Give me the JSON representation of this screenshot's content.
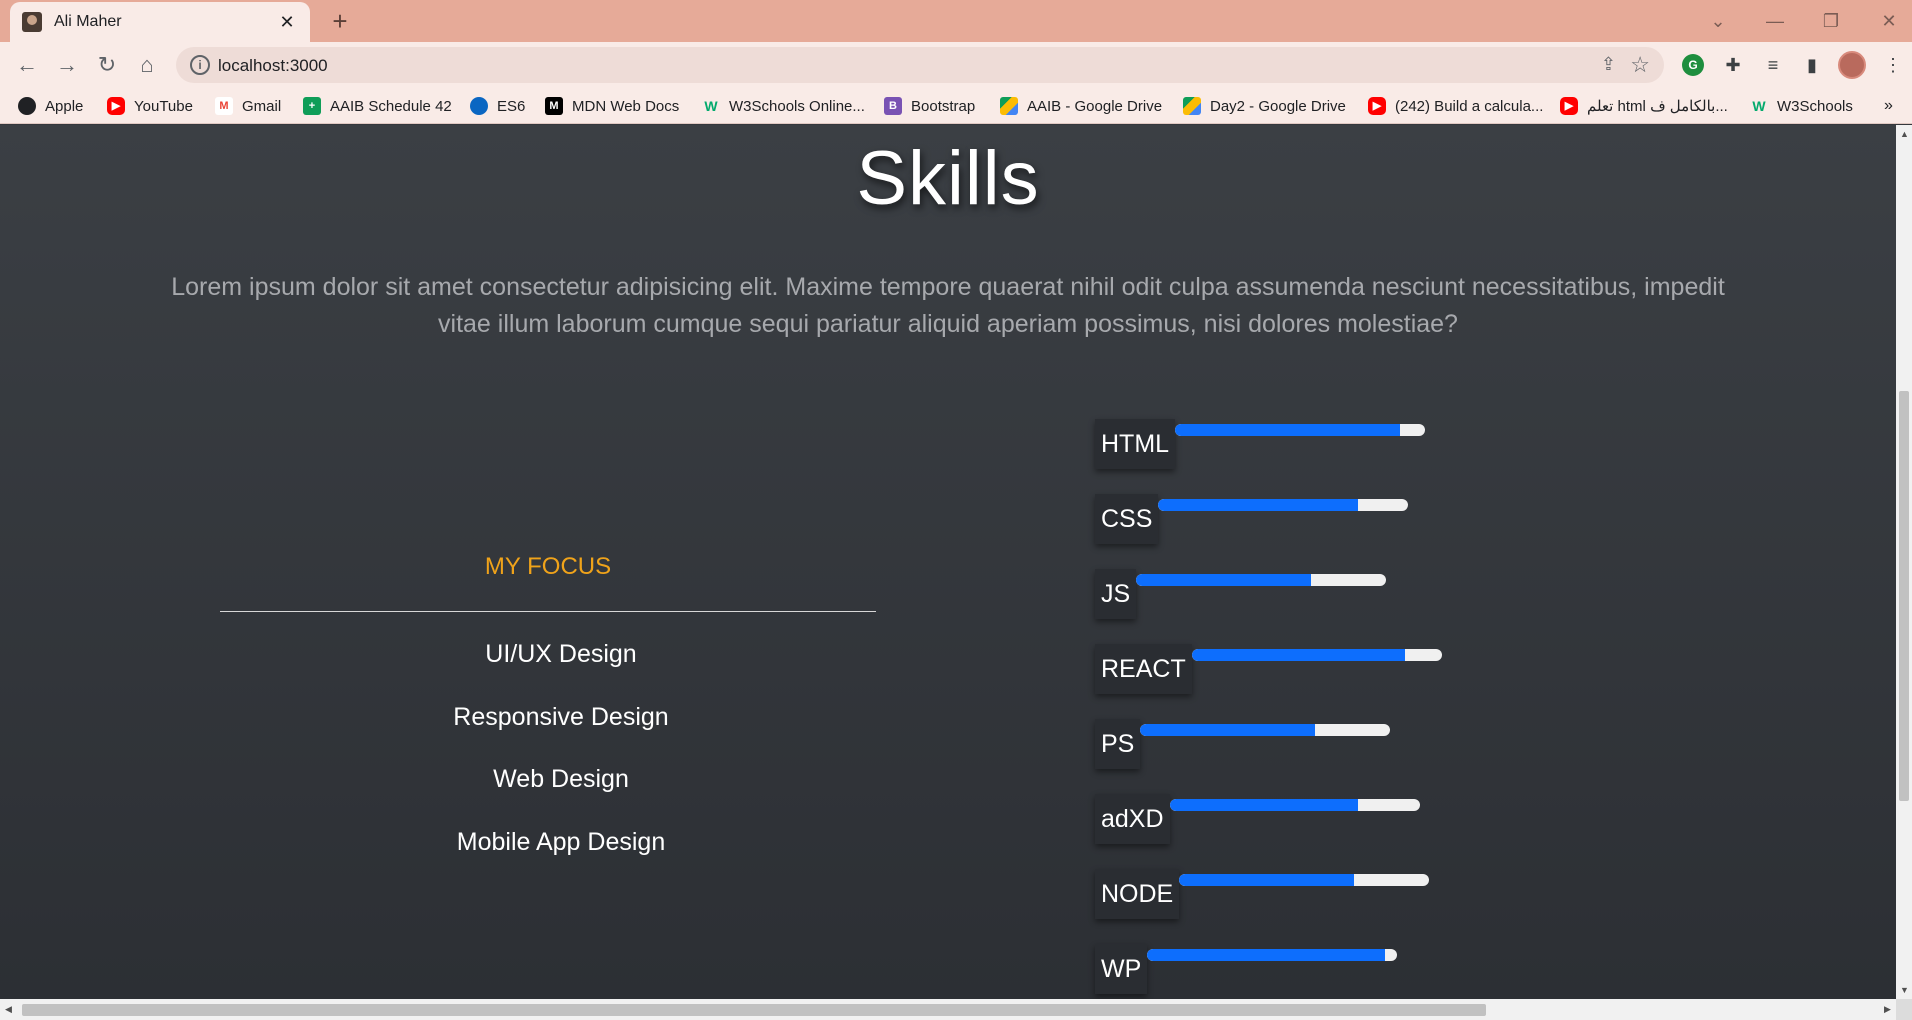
{
  "browser": {
    "tab_title": "Ali Maher",
    "new_tab": "+",
    "url": "localhost:3000",
    "accent_color": "#e6aa98"
  },
  "bookmarks": [
    {
      "label": "Apple",
      "icon": "globe-icon",
      "color": "#202124"
    },
    {
      "label": "YouTube",
      "icon": "youtube-icon",
      "color": "#ff0000"
    },
    {
      "label": "Gmail",
      "icon": "gmail-icon",
      "color": "#ea4335"
    },
    {
      "label": "AAIB Schedule 42",
      "icon": "sheets-icon",
      "color": "#0f9d58"
    },
    {
      "label": "ES6",
      "icon": "onedrive-icon",
      "color": "#0a66c2"
    },
    {
      "label": "MDN Web Docs",
      "icon": "mdn-icon",
      "color": "#000000"
    },
    {
      "label": "W3Schools Online...",
      "icon": "w3schools-icon",
      "color": "#04aa6d"
    },
    {
      "label": "Bootstrap",
      "icon": "bootstrap-icon",
      "color": "#7952b3"
    },
    {
      "label": "AAIB - Google Drive",
      "icon": "drive-icon",
      "color": "#fbbc04"
    },
    {
      "label": "Day2 - Google Drive",
      "icon": "drive-icon",
      "color": "#fbbc04"
    },
    {
      "label": "(242) Build a calcula...",
      "icon": "youtube-icon",
      "color": "#ff0000"
    },
    {
      "label": "تعلم html بالكامل ف...",
      "icon": "youtube-icon",
      "color": "#ff0000"
    },
    {
      "label": "W3Schools",
      "icon": "w3schools-icon",
      "color": "#04aa6d"
    }
  ],
  "bookmarks_overflow": "»",
  "page": {
    "title": "Skills",
    "intro": "Lorem ipsum dolor sit amet consectetur adipisicing elit. Maxime tempore quaerat nihil odit culpa assumenda nesciunt necessitatibus, impedit vitae illum laborum cumque sequi pariatur aliquid aperiam possimus, nisi dolores molestiae?",
    "focus": {
      "title": "MY FOCUS",
      "items": [
        "UI/UX Design",
        "Responsive Design",
        "Web Design",
        "Mobile App Design"
      ]
    },
    "skills": [
      {
        "name": "HTML",
        "level": 0.9
      },
      {
        "name": "CSS",
        "level": 0.8
      },
      {
        "name": "JS",
        "level": 0.7
      },
      {
        "name": "REACT",
        "level": 0.85
      },
      {
        "name": "PS",
        "level": 0.7
      },
      {
        "name": "adXD",
        "level": 0.75
      },
      {
        "name": "NODE",
        "level": 0.7
      },
      {
        "name": "WP",
        "level": 0.95
      }
    ],
    "focus_color": "#f0a31a",
    "skill_bar_color": "#0d6efd"
  }
}
